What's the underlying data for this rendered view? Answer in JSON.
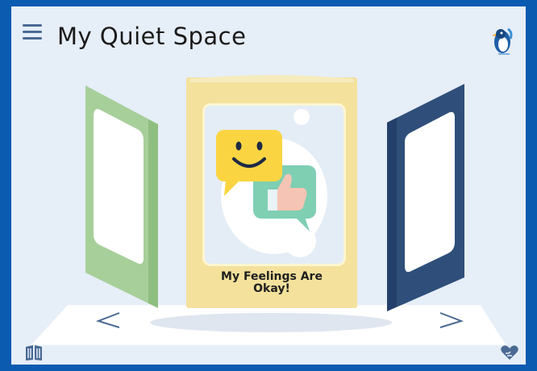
{
  "app": {
    "title": "My Quiet Space",
    "menu_icon": "hamburger-menu-icon",
    "logo_icon": "penguin-logo-icon"
  },
  "carousel": {
    "featured_book": {
      "title_line1": "My Feelings Are",
      "title_line2": "Okay!",
      "cover_color": "#f3e19c",
      "art": [
        "smiley-speech-bubble-icon",
        "thumbs-up-speech-bubble-icon"
      ]
    },
    "left_book": {
      "cover_color": "#a7cf9a"
    },
    "right_book": {
      "cover_color": "#2f4f7a"
    },
    "prev_icon": "chevron-left-icon",
    "next_icon": "chevron-right-icon"
  },
  "footer": {
    "left_icon": "library-book-icon",
    "right_icon": "heart-hands-icon"
  },
  "colors": {
    "frame": "#0b5bb0",
    "background": "#e6eef8",
    "accent": "#4a6a93"
  }
}
